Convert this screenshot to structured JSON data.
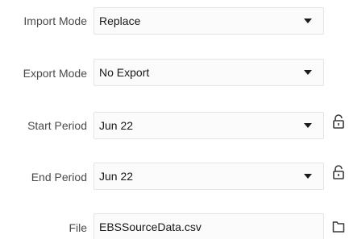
{
  "import_mode": {
    "label": "Import Mode",
    "value": "Replace"
  },
  "export_mode": {
    "label": "Export Mode",
    "value": "No Export"
  },
  "start_period": {
    "label": "Start Period",
    "value": "Jun 22",
    "icon": "unlock-icon"
  },
  "end_period": {
    "label": "End Period",
    "value": "Jun 22",
    "icon": "unlock-icon"
  },
  "file": {
    "label": "File",
    "value": "EBSSourceData.csv",
    "icon": "folder-icon"
  }
}
